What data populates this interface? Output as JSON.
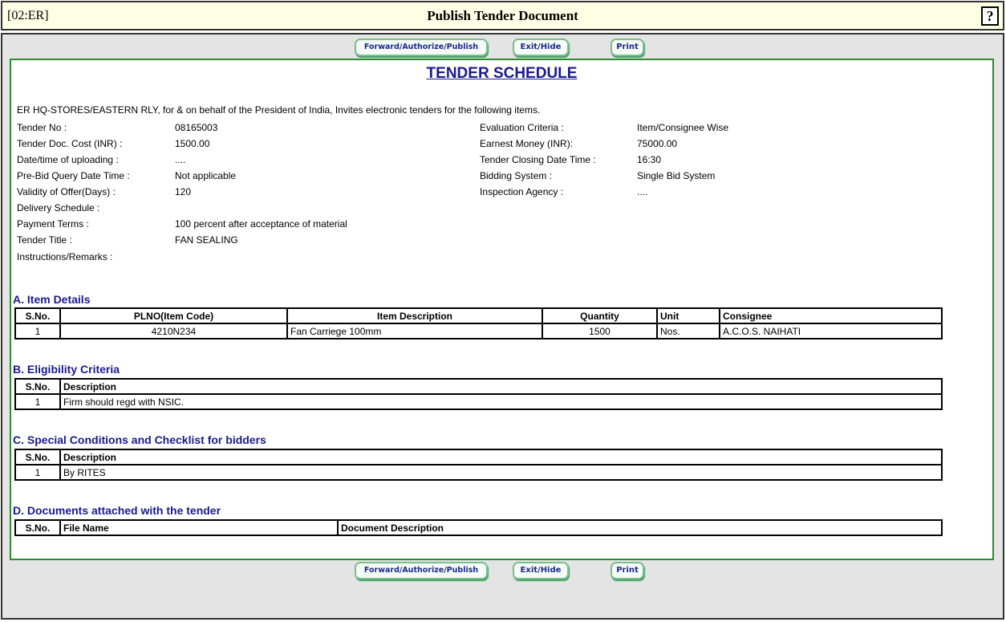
{
  "header": {
    "code": "[02:ER]",
    "title": "Publish Tender Document",
    "help_label": "?"
  },
  "buttons": {
    "forward": "Forward/Authorize/Publish",
    "exit": "Exit/Hide",
    "print": "Print"
  },
  "doc": {
    "title": "TENDER SCHEDULE",
    "intro": "ER HQ-STORES/EASTERN RLY, for & on behalf of the President of India, Invites electronic tenders for the following items.",
    "left_fields": [
      {
        "label": "Tender No :",
        "value": "08165003"
      },
      {
        "label": "Tender Doc. Cost (INR) :",
        "value": "1500.00"
      },
      {
        "label": "Date/time of uploading :",
        "value": "...."
      },
      {
        "label": "Pre-Bid Query Date Time :",
        "value": "Not applicable"
      },
      {
        "label": "Validity of Offer(Days) :",
        "value": "120"
      },
      {
        "label": "Delivery Schedule :",
        "value": ""
      },
      {
        "label": "Payment Terms :",
        "value": "100 percent after acceptance of material"
      },
      {
        "label": "Tender Title :",
        "value": "FAN SEALING"
      },
      {
        "label": "Instructions/Remarks :",
        "value": ""
      }
    ],
    "right_fields": [
      {
        "label": "Evaluation Criteria :",
        "value": "Item/Consignee Wise"
      },
      {
        "label": "Earnest Money (INR):",
        "value": "75000.00"
      },
      {
        "label": "Tender Closing Date Time :",
        "value": "16:30"
      },
      {
        "label": "Bidding System :",
        "value": "Single Bid System"
      },
      {
        "label": "Inspection Agency :",
        "value": "...."
      }
    ],
    "sections": {
      "items": {
        "heading": "A. Item Details",
        "headers": [
          "S.No.",
          "PLNO(Item Code)",
          "Item Description",
          "Quantity",
          "Unit",
          "Consignee"
        ],
        "rows": [
          [
            "1",
            "4210N234",
            "Fan Carriege 100mm",
            "1500",
            "Nos.",
            "A.C.O.S. NAIHATI"
          ]
        ]
      },
      "eligibility": {
        "heading": "B. Eligibility Criteria",
        "headers": [
          "S.No.",
          "Description"
        ],
        "rows": [
          [
            "1",
            "Firm should regd with NSIC."
          ]
        ]
      },
      "special": {
        "heading": "C. Special Conditions and Checklist for bidders",
        "headers": [
          "S.No.",
          "Description"
        ],
        "rows": [
          [
            "1",
            "By RITES"
          ]
        ]
      },
      "documents": {
        "heading": "D. Documents attached with the tender",
        "headers": [
          "S.No.",
          "File Name",
          "Document Description"
        ],
        "rows": []
      }
    }
  }
}
